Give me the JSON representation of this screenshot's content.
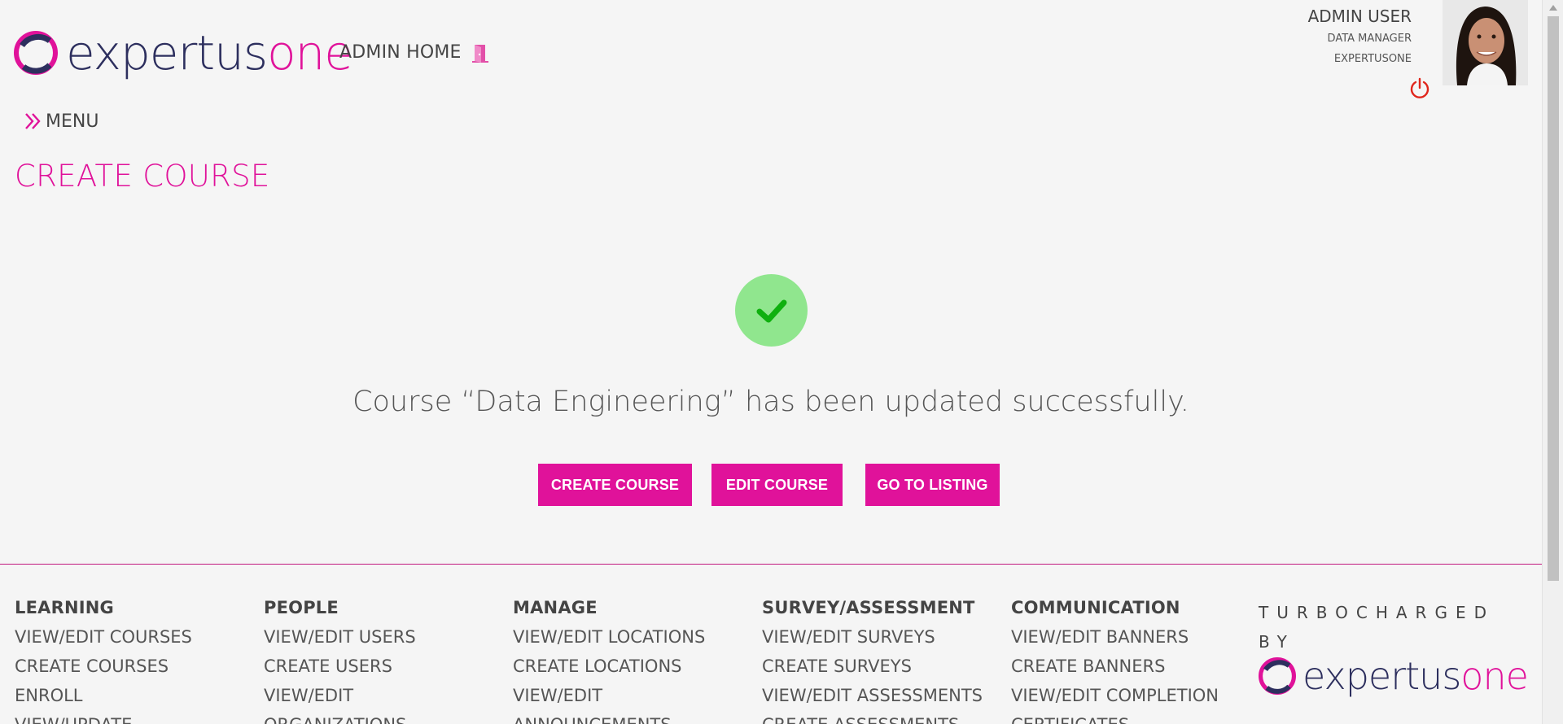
{
  "header": {
    "logo": {
      "text_a": "expertus",
      "text_b": "one"
    },
    "admin_home": "ADMIN HOME",
    "user": {
      "name": "ADMIN USER",
      "role": "DATA MANAGER",
      "org": "EXPERTUSONE"
    },
    "icons": {
      "door": "door-icon",
      "power": "power-icon"
    },
    "colors": {
      "brand_pink": "#e0129a",
      "brand_navy": "#2d2f5e",
      "power_red": "#e0261c"
    }
  },
  "menu": {
    "label": "MENU",
    "icon": "double-chevron-right-icon"
  },
  "page": {
    "title": "CREATE COURSE"
  },
  "result": {
    "icon": "checkmark-icon",
    "message": "Course “Data Engineering” has been updated successfully.",
    "success_bg": "#90e68e",
    "check_color": "#0fb00f"
  },
  "actions": {
    "create_course": "CREATE COURSE",
    "edit_course": "EDIT COURSE",
    "go_to_listing": "GO TO LISTING"
  },
  "footer": {
    "columns": [
      {
        "heading": "LEARNING",
        "links": [
          "VIEW/EDIT COURSES",
          "CREATE COURSES",
          "ENROLL",
          "VIEW/UPDATE"
        ]
      },
      {
        "heading": "PEOPLE",
        "links": [
          "VIEW/EDIT USERS",
          "CREATE USERS",
          "VIEW/EDIT",
          "ORGANIZATIONS"
        ]
      },
      {
        "heading": "MANAGE",
        "links": [
          "VIEW/EDIT LOCATIONS",
          "CREATE LOCATIONS",
          "VIEW/EDIT",
          "ANNOUNCEMENTS"
        ]
      },
      {
        "heading": "SURVEY/ASSESSMENT",
        "links": [
          "VIEW/EDIT SURVEYS",
          "CREATE SURVEYS",
          "VIEW/EDIT ASSESSMENTS",
          "CREATE ASSESSMENTS"
        ]
      },
      {
        "heading": "COMMUNICATION",
        "links": [
          "VIEW/EDIT BANNERS",
          "CREATE BANNERS",
          "VIEW/EDIT COMPLETION",
          "CERTIFICATES"
        ]
      }
    ],
    "turbo": "TURBOCHARGED BY",
    "logo": {
      "text_a": "expertus",
      "text_b": "one"
    }
  }
}
